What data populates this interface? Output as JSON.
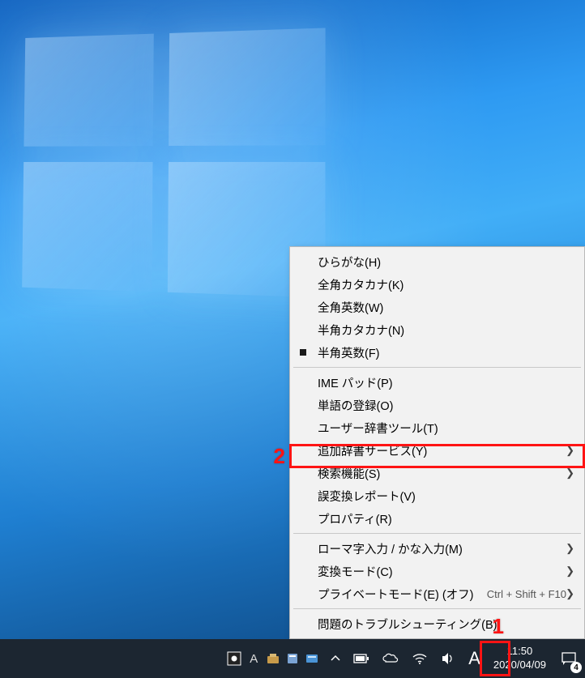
{
  "menu": {
    "group1": [
      {
        "label": "ひらがな(H)",
        "selected": false
      },
      {
        "label": "全角カタカナ(K)",
        "selected": false
      },
      {
        "label": "全角英数(W)",
        "selected": false
      },
      {
        "label": "半角カタカナ(N)",
        "selected": false
      },
      {
        "label": "半角英数(F)",
        "selected": true
      }
    ],
    "group2": [
      {
        "label": "IME パッド(P)"
      },
      {
        "label": "単語の登録(O)"
      },
      {
        "label": "ユーザー辞書ツール(T)"
      },
      {
        "label": "追加辞書サービス(Y)",
        "submenu": true
      },
      {
        "label": "検索機能(S)",
        "submenu": true
      },
      {
        "label": "誤変換レポート(V)"
      },
      {
        "label": "プロパティ(R)"
      }
    ],
    "group3": [
      {
        "label": "ローマ字入力 / かな入力(M)",
        "submenu": true
      },
      {
        "label": "変換モード(C)",
        "submenu": true
      },
      {
        "label": "プライベートモード(E) (オフ)",
        "shortcut": "Ctrl + Shift + F10",
        "submenu": true
      }
    ],
    "group4": [
      {
        "label": "問題のトラブルシューティング(B)"
      }
    ]
  },
  "taskbar": {
    "ime_letter": "A",
    "clock_time": "11:50",
    "clock_date": "2020/04/09",
    "action_center_count": "4"
  },
  "callouts": {
    "one": "1",
    "two": "2"
  }
}
